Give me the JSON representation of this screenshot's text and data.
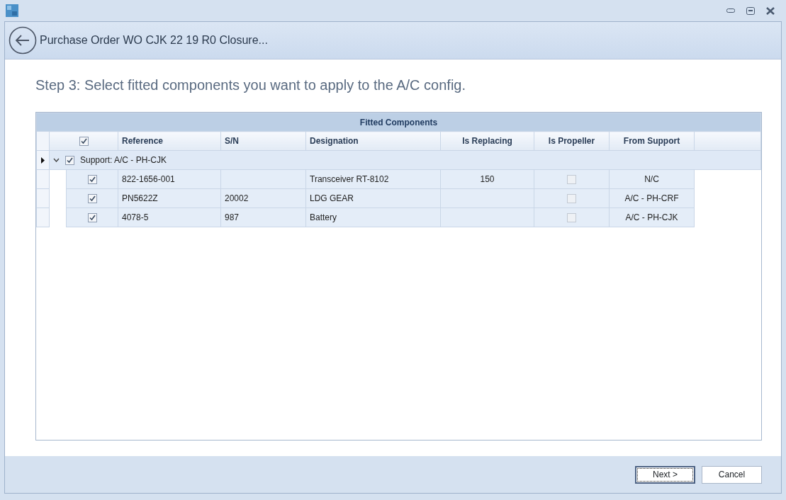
{
  "header": {
    "title": "Purchase Order WO CJK 22 19 R0 Closure..."
  },
  "step_title": "Step 3: Select fitted components you want to apply to the A/C config.",
  "grid": {
    "title": "Fitted Components",
    "select_all_checked": true,
    "columns": [
      "Reference",
      "S/N",
      "Designation",
      "Is Replacing",
      "Is Propeller",
      "From Support"
    ],
    "groups": [
      {
        "label": "Support: A/C - PH-CJK",
        "checked": true,
        "expanded": true,
        "current": true,
        "rows": [
          {
            "checked": true,
            "reference": "822-1656-001",
            "sn": "",
            "designation": "Transceiver RT-8102",
            "is_replacing": "150",
            "is_propeller": false,
            "from_support": "N/C"
          },
          {
            "checked": true,
            "reference": "PN5622Z",
            "sn": "20002",
            "designation": "LDG GEAR",
            "is_replacing": "",
            "is_propeller": false,
            "from_support": "A/C - PH-CRF"
          },
          {
            "checked": true,
            "reference": "4078-5",
            "sn": "987",
            "designation": "Battery",
            "is_replacing": "",
            "is_propeller": false,
            "from_support": "A/C - PH-CJK"
          }
        ]
      }
    ]
  },
  "buttons": [
    {
      "label": "Next >",
      "focused": true
    },
    {
      "label": "Cancel",
      "focused": false
    }
  ]
}
